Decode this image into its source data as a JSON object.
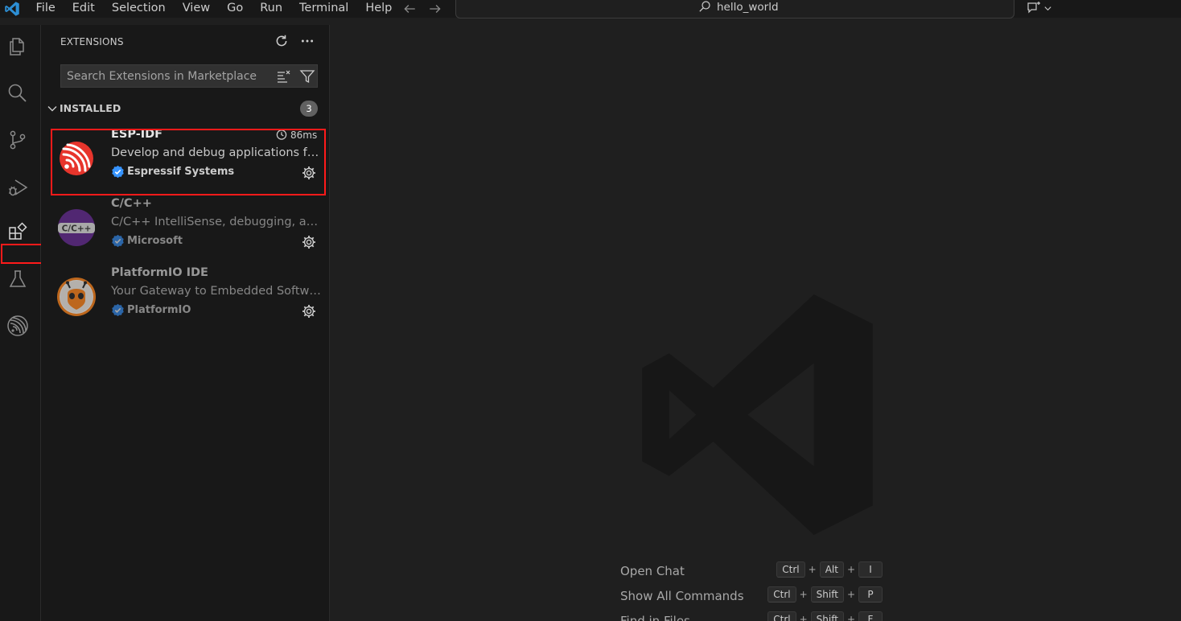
{
  "menu": [
    "File",
    "Edit",
    "Selection",
    "View",
    "Go",
    "Run",
    "Terminal",
    "Help"
  ],
  "command_center": {
    "text": "hello_world"
  },
  "sidebar": {
    "title": "EXTENSIONS",
    "search_placeholder": "Search Extensions in Marketplace",
    "section": {
      "label": "INSTALLED",
      "count": "3"
    },
    "extensions": [
      {
        "name": "ESP-IDF",
        "description": "Develop and debug applications for Espressif chips with ESP-IDF",
        "publisher": "Espressif Systems",
        "time": "86ms"
      },
      {
        "name": "C/C++",
        "description": "C/C++ IntelliSense, debugging, and code browsing.",
        "publisher": "Microsoft",
        "icon_text": "C/C++"
      },
      {
        "name": "PlatformIO IDE",
        "description": "Your Gateway to Embedded Software Development Excellence",
        "publisher": "PlatformIO"
      }
    ]
  },
  "shortcuts": [
    {
      "label": "Open Chat",
      "keys": [
        "Ctrl",
        "Alt",
        "I"
      ]
    },
    {
      "label": "Show All Commands",
      "keys": [
        "Ctrl",
        "Shift",
        "P"
      ]
    },
    {
      "label": "Find in Files",
      "keys": [
        "Ctrl",
        "Shift",
        "F"
      ]
    }
  ],
  "colors": {
    "accent": "#3794ff",
    "highlight": "#ff1a1a",
    "espressif": "#e7352c",
    "cpp": "#652d90",
    "platformio": "#f5821f"
  },
  "icons": [
    "vscode-logo",
    "explorer-icon",
    "search-icon",
    "source-control-icon",
    "run-debug-icon",
    "extensions-icon",
    "testing-icon",
    "espressif-icon"
  ]
}
